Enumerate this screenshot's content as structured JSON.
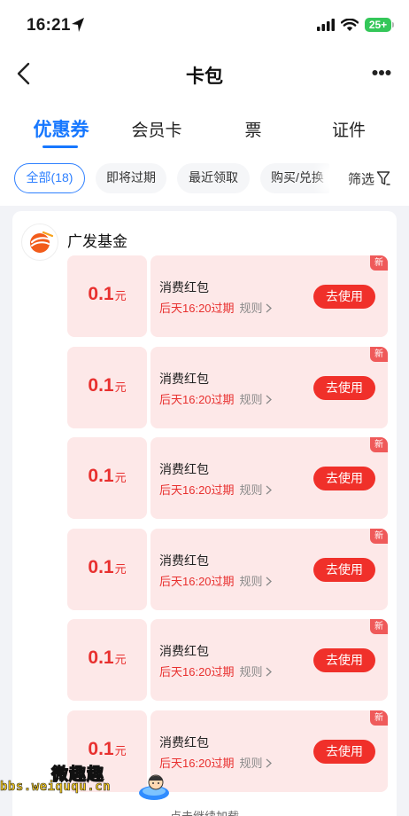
{
  "status": {
    "time": "16:21",
    "battery": "25+"
  },
  "nav": {
    "title": "卡包"
  },
  "tabs": [
    {
      "label": "优惠券",
      "active": true
    },
    {
      "label": "会员卡",
      "active": false
    },
    {
      "label": "票",
      "active": false
    },
    {
      "label": "证件",
      "active": false
    }
  ],
  "filters": [
    {
      "label": "全部(18)",
      "active": true
    },
    {
      "label": "即将过期",
      "active": false
    },
    {
      "label": "最近领取",
      "active": false
    },
    {
      "label": "购买/兑换",
      "active": false
    }
  ],
  "filter_button": {
    "label": "筛选"
  },
  "merchant": {
    "name": "广发基金"
  },
  "coupons": [
    {
      "amount": "0.1",
      "unit": "元",
      "title": "消费红包",
      "expiry": "后天16:20过期",
      "rules": "规则",
      "button": "去使用",
      "badge": "新"
    },
    {
      "amount": "0.1",
      "unit": "元",
      "title": "消费红包",
      "expiry": "后天16:20过期",
      "rules": "规则",
      "button": "去使用",
      "badge": "新"
    },
    {
      "amount": "0.1",
      "unit": "元",
      "title": "消费红包",
      "expiry": "后天16:20过期",
      "rules": "规则",
      "button": "去使用",
      "badge": "新"
    },
    {
      "amount": "0.1",
      "unit": "元",
      "title": "消费红包",
      "expiry": "后天16:20过期",
      "rules": "规则",
      "button": "去使用",
      "badge": "新"
    },
    {
      "amount": "0.1",
      "unit": "元",
      "title": "消费红包",
      "expiry": "后天16:20过期",
      "rules": "规则",
      "button": "去使用",
      "badge": "新"
    },
    {
      "amount": "0.1",
      "unit": "元",
      "title": "消费红包",
      "expiry": "后天16:20过期",
      "rules": "规则",
      "button": "去使用",
      "badge": "新"
    }
  ],
  "footer": {
    "load_more": "点击继续加载"
  },
  "watermark": {
    "name": "微趣趣",
    "url": "bbs.weiququ.cn"
  },
  "colors": {
    "accent": "#1677ff",
    "coupon_red": "#e8302f",
    "coupon_bg": "#fde8e8"
  },
  "icons": [
    "location-arrow-icon",
    "signal-icon",
    "wifi-icon",
    "battery-icon",
    "back-chevron-icon",
    "more-dots-icon",
    "filter-funnel-icon",
    "guangfa-logo-icon",
    "chevron-right-icon"
  ]
}
